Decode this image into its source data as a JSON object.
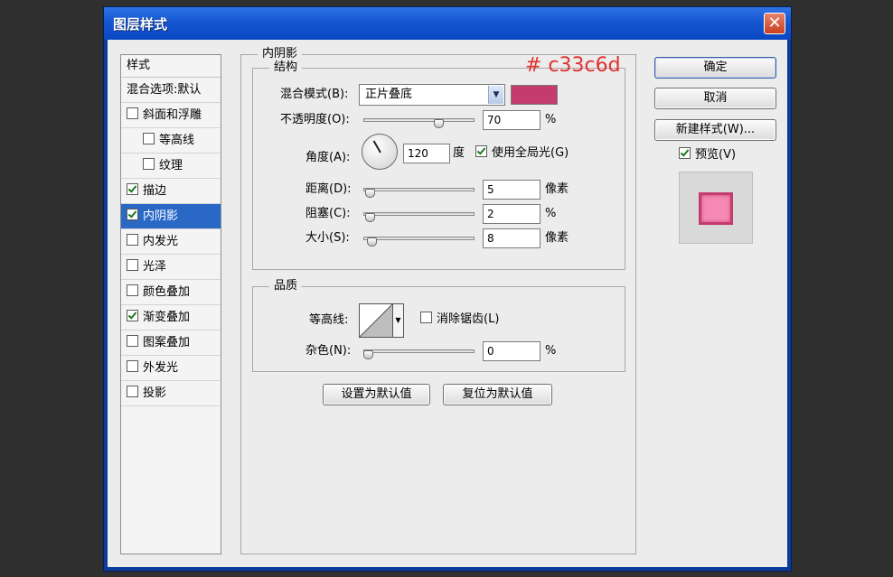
{
  "window": {
    "title": "图层样式",
    "close_glyph": "✕"
  },
  "styles_list": {
    "header": "样式",
    "items": [
      {
        "label": "混合选项:默认",
        "checkbox": false,
        "checked": false,
        "indent": false,
        "selected": false
      },
      {
        "label": "斜面和浮雕",
        "checkbox": true,
        "checked": false,
        "indent": false,
        "selected": false
      },
      {
        "label": "等高线",
        "checkbox": true,
        "checked": false,
        "indent": true,
        "selected": false
      },
      {
        "label": "纹理",
        "checkbox": true,
        "checked": false,
        "indent": true,
        "selected": false
      },
      {
        "label": "描边",
        "checkbox": true,
        "checked": true,
        "indent": false,
        "selected": false
      },
      {
        "label": "内阴影",
        "checkbox": true,
        "checked": true,
        "indent": false,
        "selected": true
      },
      {
        "label": "内发光",
        "checkbox": true,
        "checked": false,
        "indent": false,
        "selected": false
      },
      {
        "label": "光泽",
        "checkbox": true,
        "checked": false,
        "indent": false,
        "selected": false
      },
      {
        "label": "颜色叠加",
        "checkbox": true,
        "checked": false,
        "indent": false,
        "selected": false
      },
      {
        "label": "渐变叠加",
        "checkbox": true,
        "checked": true,
        "indent": false,
        "selected": false
      },
      {
        "label": "图案叠加",
        "checkbox": true,
        "checked": false,
        "indent": false,
        "selected": false
      },
      {
        "label": "外发光",
        "checkbox": true,
        "checked": false,
        "indent": false,
        "selected": false
      },
      {
        "label": "投影",
        "checkbox": true,
        "checked": false,
        "indent": false,
        "selected": false
      }
    ]
  },
  "inner_shadow": {
    "panel_title": "内阴影",
    "hex_note": "# c33c6d",
    "structure": {
      "title": "结构",
      "blend_mode_label": "混合模式(B):",
      "blend_mode_value": "正片叠底",
      "color": "#c33c6d",
      "opacity_label": "不透明度(O):",
      "opacity_value": "70",
      "opacity_unit": "%",
      "opacity_fraction": 0.7,
      "angle_label": "角度(A):",
      "angle_value": "120",
      "angle_unit": "度",
      "global_light_label": "使用全局光(G)",
      "global_light_checked": true,
      "distance_label": "距离(D):",
      "distance_value": "5",
      "distance_unit": "像素",
      "distance_fraction": 0.02,
      "choke_label": "阻塞(C):",
      "choke_value": "2",
      "choke_unit": "%",
      "choke_fraction": 0.02,
      "size_label": "大小(S):",
      "size_value": "8",
      "size_unit": "像素",
      "size_fraction": 0.04
    },
    "quality": {
      "title": "品质",
      "contour_label": "等高线:",
      "antialias_label": "消除锯齿(L)",
      "antialias_checked": false,
      "noise_label": "杂色(N):",
      "noise_value": "0",
      "noise_unit": "%",
      "noise_fraction": 0.0
    },
    "make_default_label": "设置为默认值",
    "reset_default_label": "复位为默认值"
  },
  "actions": {
    "ok_label": "确定",
    "cancel_label": "取消",
    "new_style_label": "新建样式(W)...",
    "preview_label": "预览(V)",
    "preview_checked": true
  },
  "colors": {
    "accent": "#c33c6d",
    "preview_fill": "#f58ab4",
    "selection": "#2a68c6"
  }
}
